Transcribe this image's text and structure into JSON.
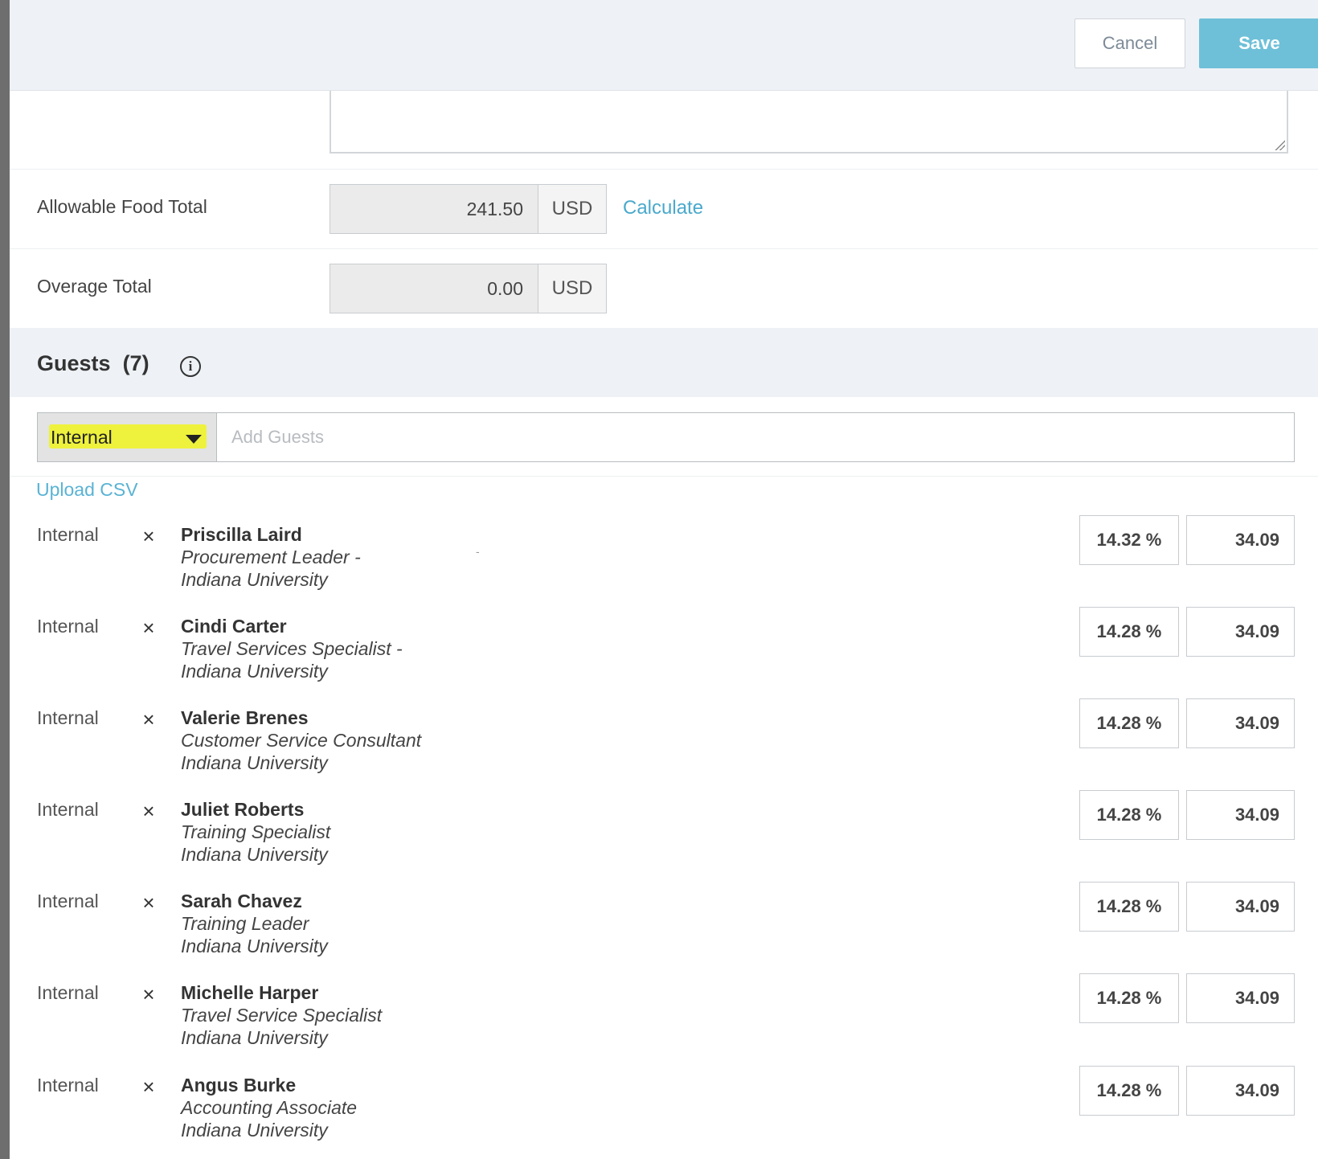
{
  "header": {
    "cancel_label": "Cancel",
    "save_label": "Save"
  },
  "fields": {
    "allowable_food_total": {
      "label": "Allowable Food Total",
      "value": "241.50",
      "currency": "USD",
      "action_label": "Calculate"
    },
    "overage_total": {
      "label": "Overage Total",
      "value": "0.00",
      "currency": "USD"
    }
  },
  "guests": {
    "title": "Guests",
    "count": "(7)",
    "info_icon": "info-icon",
    "type_select_value": "Internal",
    "add_placeholder": "Add Guests",
    "upload_label": "Upload CSV",
    "remove_symbol": "×",
    "list": [
      {
        "type": "Internal",
        "name": "Priscilla Laird",
        "title": "Procurement Leader -",
        "org": "Indiana University",
        "percent": "14.32 %",
        "amount": "34.09"
      },
      {
        "type": "Internal",
        "name": "Cindi Carter",
        "title": "Travel Services Specialist -",
        "org": "Indiana University",
        "percent": "14.28 %",
        "amount": "34.09"
      },
      {
        "type": "Internal",
        "name": "Valerie Brenes",
        "title": "Customer Service Consultant",
        "org": "Indiana University",
        "percent": "14.28 %",
        "amount": "34.09"
      },
      {
        "type": "Internal",
        "name": "Juliet Roberts",
        "title": "Training Specialist",
        "org": "Indiana University",
        "percent": "14.28 %",
        "amount": "34.09"
      },
      {
        "type": "Internal",
        "name": "Sarah Chavez",
        "title": "Training Leader",
        "org": "Indiana University",
        "percent": "14.28 %",
        "amount": "34.09"
      },
      {
        "type": "Internal",
        "name": "Michelle Harper",
        "title": "Travel Service Specialist",
        "org": "Indiana University",
        "percent": "14.28 %",
        "amount": "34.09"
      },
      {
        "type": "Internal",
        "name": "Angus Burke",
        "title": "Accounting Associate",
        "org": "Indiana University",
        "percent": "14.28 %",
        "amount": "34.09"
      }
    ]
  },
  "colors": {
    "accent": "#6ec0d8",
    "link": "#4aa9cc",
    "highlight": "#eef23c",
    "section_bg": "#eef2f6"
  }
}
